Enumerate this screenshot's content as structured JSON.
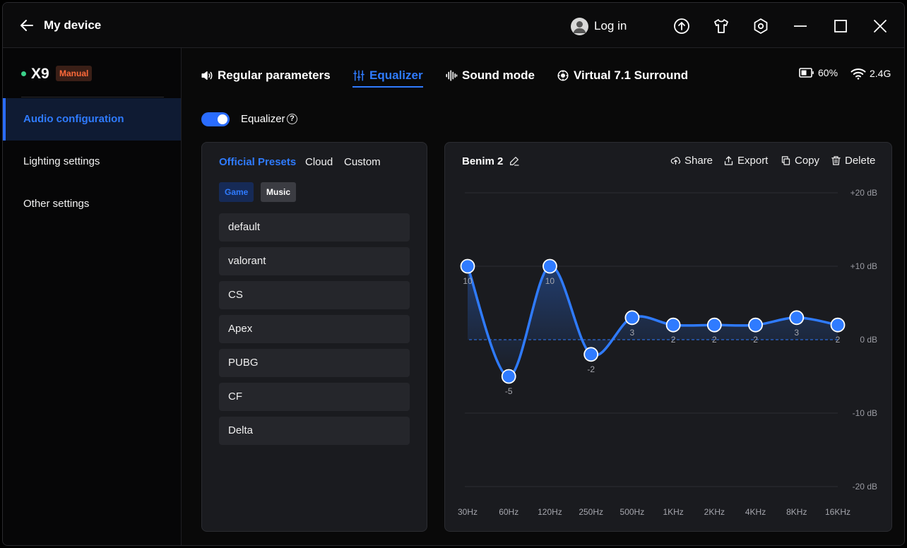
{
  "header": {
    "title": "My device",
    "login_label": "Log in"
  },
  "sidebar": {
    "device_name": "X9",
    "device_badge": "Manual",
    "items": [
      {
        "label": "Audio configuration",
        "active": true
      },
      {
        "label": "Lighting settings",
        "active": false
      },
      {
        "label": "Other settings",
        "active": false
      }
    ]
  },
  "tabs": [
    {
      "label": "Regular parameters",
      "icon": "speaker-icon",
      "active": false
    },
    {
      "label": "Equalizer",
      "icon": "sliders-icon",
      "active": true
    },
    {
      "label": "Sound mode",
      "icon": "waveform-icon",
      "active": false
    },
    {
      "label": "Virtual 7.1 Surround",
      "icon": "surround-icon",
      "active": false
    }
  ],
  "status": {
    "battery": "60%",
    "wireless": "2.4G"
  },
  "equalizer": {
    "label": "Equalizer",
    "enabled": true,
    "help": "?"
  },
  "presets": {
    "tabs": [
      {
        "label": "Official Presets",
        "active": true
      },
      {
        "label": "Cloud",
        "active": false
      },
      {
        "label": "Custom",
        "active": false
      }
    ],
    "categories": [
      {
        "label": "Game",
        "active": true
      },
      {
        "label": "Music",
        "active": false
      }
    ],
    "items": [
      "default",
      "valorant",
      "CS",
      "Apex",
      "PUBG",
      "CF",
      "Delta"
    ]
  },
  "eq_panel": {
    "preset_name": "Benim 2",
    "actions": {
      "share": "Share",
      "export": "Export",
      "copy": "Copy",
      "delete": "Delete"
    }
  },
  "colors": {
    "accent": "#2f7bff",
    "badge": "#ff6a3a",
    "status_dot": "#3bd18a"
  },
  "chart_data": {
    "type": "line",
    "categories": [
      "30Hz",
      "60Hz",
      "120Hz",
      "250Hz",
      "500Hz",
      "1KHz",
      "2KHz",
      "4KHz",
      "8KHz",
      "16KHz"
    ],
    "values": [
      10,
      -5,
      10,
      -2,
      3,
      2,
      2,
      2,
      3,
      2
    ],
    "y_ticks": [
      "+20 dB",
      "+10 dB",
      "0 dB",
      "-10 dB",
      "-20 dB"
    ],
    "ylim": [
      -20,
      20
    ],
    "grid": true
  }
}
